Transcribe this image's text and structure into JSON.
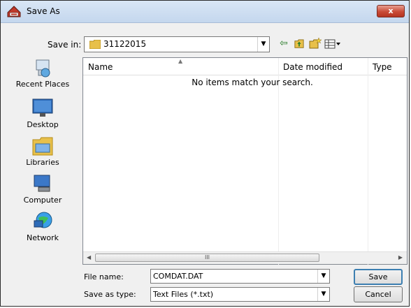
{
  "window": {
    "title": "Save As",
    "close_label": "x"
  },
  "save_in": {
    "label": "Save in:",
    "value": "31122015"
  },
  "toolbar": {
    "back_icon": "arrow-left-icon",
    "up_icon": "up-folder-icon",
    "new_folder_icon": "new-folder-icon",
    "views_icon": "views-menu-icon"
  },
  "places": [
    {
      "label": "Recent Places",
      "icon": "recent-places-icon"
    },
    {
      "label": "Desktop",
      "icon": "desktop-icon"
    },
    {
      "label": "Libraries",
      "icon": "libraries-icon"
    },
    {
      "label": "Computer",
      "icon": "computer-icon"
    },
    {
      "label": "Network",
      "icon": "network-icon"
    }
  ],
  "file_list": {
    "columns": [
      "Name",
      "Date modified",
      "Type"
    ],
    "empty_message": "No items match your search.",
    "scroll_thumb_label": "III"
  },
  "file_name": {
    "label": "File name:",
    "value": "COMDAT.DAT"
  },
  "save_as_type": {
    "label": "Save as type:",
    "value": "Text Files (*.txt)"
  },
  "buttons": {
    "save": "Save",
    "cancel": "Cancel"
  }
}
